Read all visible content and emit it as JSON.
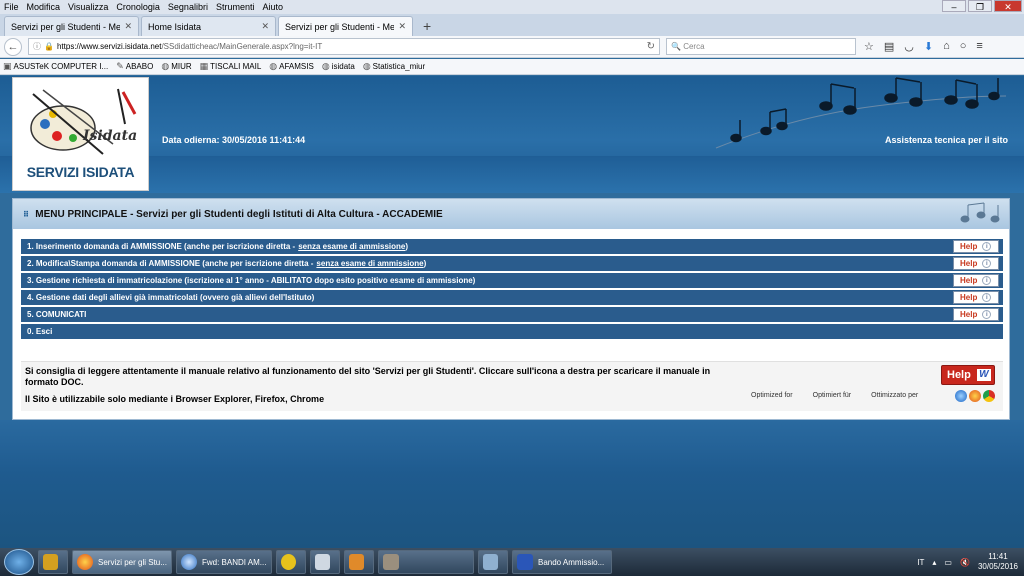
{
  "menu": [
    "File",
    "Modifica",
    "Visualizza",
    "Cronologia",
    "Segnalibri",
    "Strumenti",
    "Aiuto"
  ],
  "tabs": [
    {
      "label": "Servizi per gli Studenti - Menu ..."
    },
    {
      "label": "Home Isidata"
    },
    {
      "label": "Servizi per gli Studenti - Menu ..."
    }
  ],
  "nav": {
    "url_host": "https://www.servizi.isidata.net",
    "url_path": "/SSdidatticheac/MainGenerale.aspx?lng=it-IT",
    "search_placeholder": "Cerca"
  },
  "bookmarks": [
    "ASUSTeK COMPUTER I...",
    "ABABO",
    "MIUR",
    "TISCALI MAIL",
    "AFAMSIS",
    "isidata",
    "Statistica_miur"
  ],
  "header": {
    "servizi": "SERVIZI ISIDATA",
    "brand": "Isidata",
    "date": "Data odierna: 30/05/2016 11:41:44",
    "assist": "Assistenza tecnica per il sito"
  },
  "main": {
    "title": "MENU PRINCIPALE - Servizi per gli Studenti degli Istituti di Alta Cultura - ACCADEMIE",
    "help_label": "Help",
    "items": [
      {
        "text": "1. Inserimento domanda di AMMISSIONE (anche per iscrizione diretta - ",
        "link": "senza esame di ammissione",
        "after": ")"
      },
      {
        "text": "2. Modifica\\Stampa domanda di AMMISSIONE (anche per iscrizione diretta - ",
        "link": "senza esame di ammissione",
        "after": ")"
      },
      {
        "text": "3. Gestione richiesta di immatricolazione (iscrizione al 1° anno - ABILITATO dopo esito positivo esame di ammissione)",
        "link": "",
        "after": ""
      },
      {
        "text": "4. Gestione dati degli allievi già immatricolati (ovvero già allievi dell'Istituto)",
        "link": "",
        "after": ""
      },
      {
        "text": "5. COMUNICATI",
        "link": "",
        "after": ""
      },
      {
        "text": "0. Esci",
        "link": "",
        "after": ""
      }
    ],
    "info1": "Si consiglia di leggere attentamente il manuale relativo al funzionamento del sito 'Servizi per gli Studenti'. Cliccare sull'icona a destra per scaricare il manuale in formato DOC.",
    "info2": "Il Sito è utilizzabile solo mediante i Browser Explorer, Firefox, Chrome",
    "big_help": "Help",
    "optimized": [
      "Optimized for",
      "Optimiert für",
      "Ottimizzato per"
    ]
  },
  "taskbar": {
    "items": [
      "Servizi per gli Stu...",
      "Fwd: BANDI AM...",
      "Bando Ammissio..."
    ],
    "lang": "IT",
    "time": "11:41",
    "date": "30/05/2016"
  }
}
